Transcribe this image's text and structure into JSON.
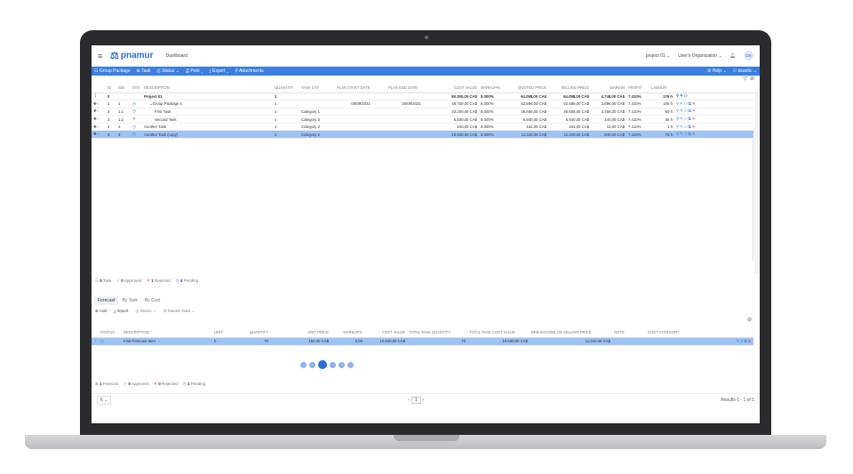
{
  "app": {
    "brand": "pnamur",
    "nav_title": "Dashboard",
    "project_select": "project 01",
    "org_select": "User's Organization",
    "user": "dsantic",
    "avatar_initials": "DS"
  },
  "toolbar": {
    "items": [
      "Group Package",
      "Task",
      "Status",
      "Print",
      "Export",
      "Attachments"
    ],
    "help": "Help",
    "user_menu": "dsantic"
  },
  "grid": {
    "columns": [
      "",
      "ID",
      "SID",
      "STS",
      "DESCRIPTION",
      "QUANTITY",
      "TASK CAT",
      "PLAN START DATE",
      "PLAN END DATE",
      "COST VALUE",
      "MARKUP%",
      "QUOTED PRICE",
      "SELLING PRICE",
      "MARGIN",
      "PROFIT",
      "LABOUR",
      ""
    ],
    "rows": [
      {
        "id": "0",
        "sid": "",
        "sts": "",
        "desc": "Project 01",
        "qty": "1",
        "cat": "",
        "start": "",
        "end": "",
        "cost": "59.350,00 CA$",
        "markup": "8.000%",
        "quoted": "64.098,00 CA$",
        "selling": "64.098,00 CA$",
        "margin": "4.748,00 CA$",
        "profit": "7.410%",
        "labour": "176 h",
        "bold": true
      },
      {
        "id": "1",
        "sid": "1",
        "sts": "pending",
        "desc": "⌄Group Package 1",
        "qty": "1",
        "cat": "",
        "start": "08/09/2021",
        "end": "25/09/2021",
        "cost": "48.700,00 CA$",
        "markup": "8.000%",
        "quoted": "52.596,00 CA$",
        "selling": "52.596,00 CA$",
        "margin": "3.896,00 CA$",
        "profit": "7.410%",
        "labour": "105 h",
        "bold": false
      },
      {
        "id": "2",
        "sid": "1.1",
        "sts": "pending",
        "desc": "First Task",
        "qty": "1",
        "cat": "Category 1",
        "start": "",
        "end": "",
        "cost": "43.200,00 CA$",
        "markup": "8.000%",
        "quoted": "46.656,00 CA$",
        "selling": "46.656,00 CA$",
        "margin": "3.456,00 CA$",
        "profit": "7.410%",
        "labour": "50 h",
        "bold": false
      },
      {
        "id": "3",
        "sid": "1.2",
        "sts": "rejected",
        "desc": "Second Task",
        "qty": "1",
        "cat": "Category 2",
        "start": "",
        "end": "",
        "cost": "5.500,00 CA$",
        "markup": "8.000%",
        "quoted": "5.940,00 CA$",
        "selling": "5.940,00 CA$",
        "margin": "440,00 CA$",
        "profit": "7.410%",
        "labour": "55 h",
        "bold": false
      },
      {
        "id": "4",
        "sid": "2",
        "sts": "pending",
        "desc": "Another Task",
        "qty": "1",
        "cat": "Category 2",
        "start": "",
        "end": "",
        "cost": "150,00 CA$",
        "markup": "8.000%",
        "quoted": "162,00 CA$",
        "selling": "162,00 CA$",
        "margin": "12,00 CA$",
        "profit": "7.410%",
        "labour": "1 h",
        "bold": false
      },
      {
        "id": "5",
        "sid": "3",
        "sts": "pending",
        "desc": "Another Task (copy)",
        "qty": "1",
        "cat": "Category 2",
        "start": "",
        "end": "",
        "cost": "10.500,00 CA$",
        "markup": "8.000%",
        "quoted": "11.340,00 CA$",
        "selling": "11.340,00 CA$",
        "margin": "840,00 CA$",
        "profit": "7.410%",
        "labour": "70 h",
        "bold": false,
        "selected": true
      }
    ]
  },
  "summary": {
    "task_count": "5",
    "task_label": "Task",
    "approved_count": "0",
    "approved_label": "Approved",
    "rejected_count": "1",
    "rejected_label": "Rejected",
    "pending_count": "4",
    "pending_label": "Pending"
  },
  "tabs": [
    "Forecast",
    "By Task",
    "By Cost"
  ],
  "subtools": [
    "Add",
    "Import",
    "Status",
    "Master Data"
  ],
  "forecast": {
    "columns": [
      "",
      "STATUS",
      "DESCRIPTION",
      "UNIT",
      "QUANTITY",
      "UNIT PRICE",
      "MARKUP%",
      "COST VALUE",
      "TOTAL TASK QUANTITY",
      "TOTAL TASK COST VALUE",
      "BREAKDOWN ON SELLING PRICE",
      "NOTE",
      "COST CATEGORY",
      ""
    ],
    "rows": [
      {
        "status": "pending",
        "desc": "First Forecast Item",
        "unit": "h",
        "qty": "70",
        "unit_price": "150,00 CA$",
        "markup": "0,00",
        "cost": "10.500,00 CA$",
        "ttq": "70",
        "ttcv": "10.500,00 CA$",
        "breakdown": "11.340,00 CA$",
        "note": "",
        "cost_cat": ""
      }
    ]
  },
  "summary2": {
    "forecast_count": "1",
    "forecast_label": "Forecast",
    "approved_count": "0",
    "approved_label": "Approved",
    "rejected_count": "0",
    "rejected_label": "Rejected",
    "pending_count": "1",
    "pending_label": "Pending"
  },
  "pager": {
    "page_size": "6",
    "current_page": "1",
    "results": "Results 1 - 1 of 1"
  },
  "colors": {
    "accent": "#3a7fe0",
    "selected": "#9cc3f5",
    "rejected": "#e0313b",
    "approved": "#2aa13a"
  }
}
